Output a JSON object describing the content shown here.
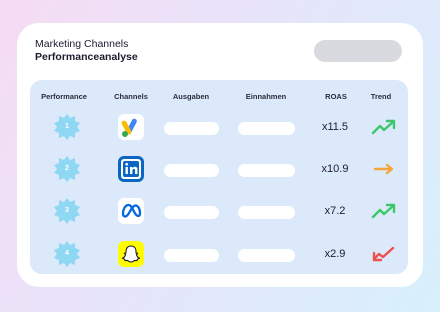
{
  "header": {
    "title": "Marketing Channels",
    "subtitle": "Performanceanalyse"
  },
  "columns": [
    "Performance",
    "Channels",
    "Ausgaben",
    "Einnahmen",
    "ROAS",
    "Trend"
  ],
  "rows": [
    {
      "rank": "1",
      "channel_icon": "google-ads-icon",
      "roas": "x11.5",
      "trend": "up",
      "trend_color": "#3cc86a"
    },
    {
      "rank": "2",
      "channel_icon": "linkedin-icon",
      "roas": "x10.9",
      "trend": "flat",
      "trend_color": "#f5a43a"
    },
    {
      "rank": "3",
      "channel_icon": "meta-icon",
      "roas": "x7.2",
      "trend": "up",
      "trend_color": "#3cc86a"
    },
    {
      "rank": "4",
      "channel_icon": "snapchat-icon",
      "roas": "x2.9",
      "trend": "down",
      "trend_color": "#ee4f4f"
    }
  ],
  "colors": {
    "rank_badge": "#8fd8f3",
    "linkedin": "#0a66c2",
    "meta": "#0668e1",
    "snapchat": "#fffc00",
    "google_blue": "#4285f4",
    "google_yellow": "#fbbc04",
    "google_green": "#34a853"
  }
}
